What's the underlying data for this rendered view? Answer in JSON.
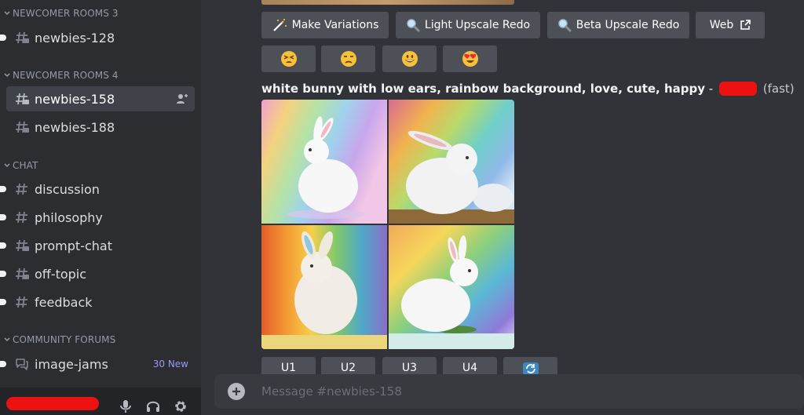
{
  "sidebar": {
    "categories": [
      {
        "label": "NEWCOMER ROOMS 3"
      },
      {
        "label": "NEWCOMER ROOMS 4"
      },
      {
        "label": "CHAT"
      },
      {
        "label": "COMMUNITY FORUMS"
      }
    ],
    "channels": [
      {
        "label": "newbies-128"
      },
      {
        "label": "newbies-158"
      },
      {
        "label": "newbies-188"
      },
      {
        "label": "discussion"
      },
      {
        "label": "philosophy"
      },
      {
        "label": "prompt-chat"
      },
      {
        "label": "off-topic"
      },
      {
        "label": "feedback"
      },
      {
        "label": "image-jams",
        "badge": "30 New"
      }
    ],
    "selected_channel": "newbies-158"
  },
  "message": {
    "buttons": {
      "make_variations": "Make Variations",
      "light_upscale_redo": "Light Upscale Redo",
      "beta_upscale_redo": "Beta Upscale Redo",
      "web": "Web"
    },
    "reactions": [
      "tired-face-emoji",
      "unamused-face-emoji",
      "grinning-face-emoji",
      "heart-eyes-emoji"
    ],
    "prompt_text": "white bunny with low ears, rainbow background, love, cute, happy",
    "prompt_separator": "-",
    "speed": "(fast)",
    "upscale_buttons": [
      "U1",
      "U2",
      "U3",
      "U4"
    ]
  },
  "composer": {
    "placeholder": "Message #newbies-158"
  },
  "colors": {
    "accent": "#949cf7",
    "redaction": "#ee1111",
    "button": "#4e5058"
  }
}
